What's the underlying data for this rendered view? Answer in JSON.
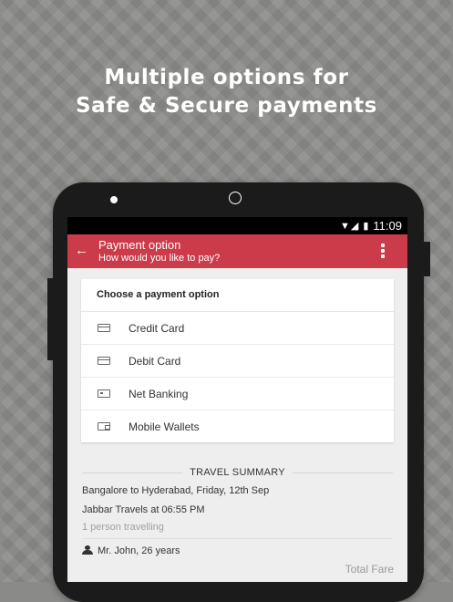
{
  "promo": {
    "headline_line1": "Multiple options for",
    "headline_line2": "Safe & Secure payments"
  },
  "status_bar": {
    "time": "11:09",
    "icons": [
      "wifi-icon",
      "signal-icon",
      "battery-icon"
    ]
  },
  "app_bar": {
    "title": "Payment option",
    "subtitle": "How would you like to pay?",
    "back_icon": "back-arrow-icon",
    "menu_icon": "overflow-menu-icon",
    "color": "#cc3b4a"
  },
  "payment": {
    "header": "Choose a payment option",
    "options": [
      {
        "label": "Credit Card",
        "icon": "credit-card-icon"
      },
      {
        "label": "Debit Card",
        "icon": "debit-card-icon"
      },
      {
        "label": "Net Banking",
        "icon": "net-banking-icon"
      },
      {
        "label": "Mobile Wallets",
        "icon": "wallet-icon"
      }
    ]
  },
  "summary": {
    "title": "TRAVEL SUMMARY",
    "route": "Bangalore to Hyderabad, Friday, 12th  Sep",
    "operator": "Jabbar  Travels at 06:55 PM",
    "travellers": "1 person travelling",
    "passenger": "Mr. John, 26 years",
    "total_label": "Total Fare"
  }
}
